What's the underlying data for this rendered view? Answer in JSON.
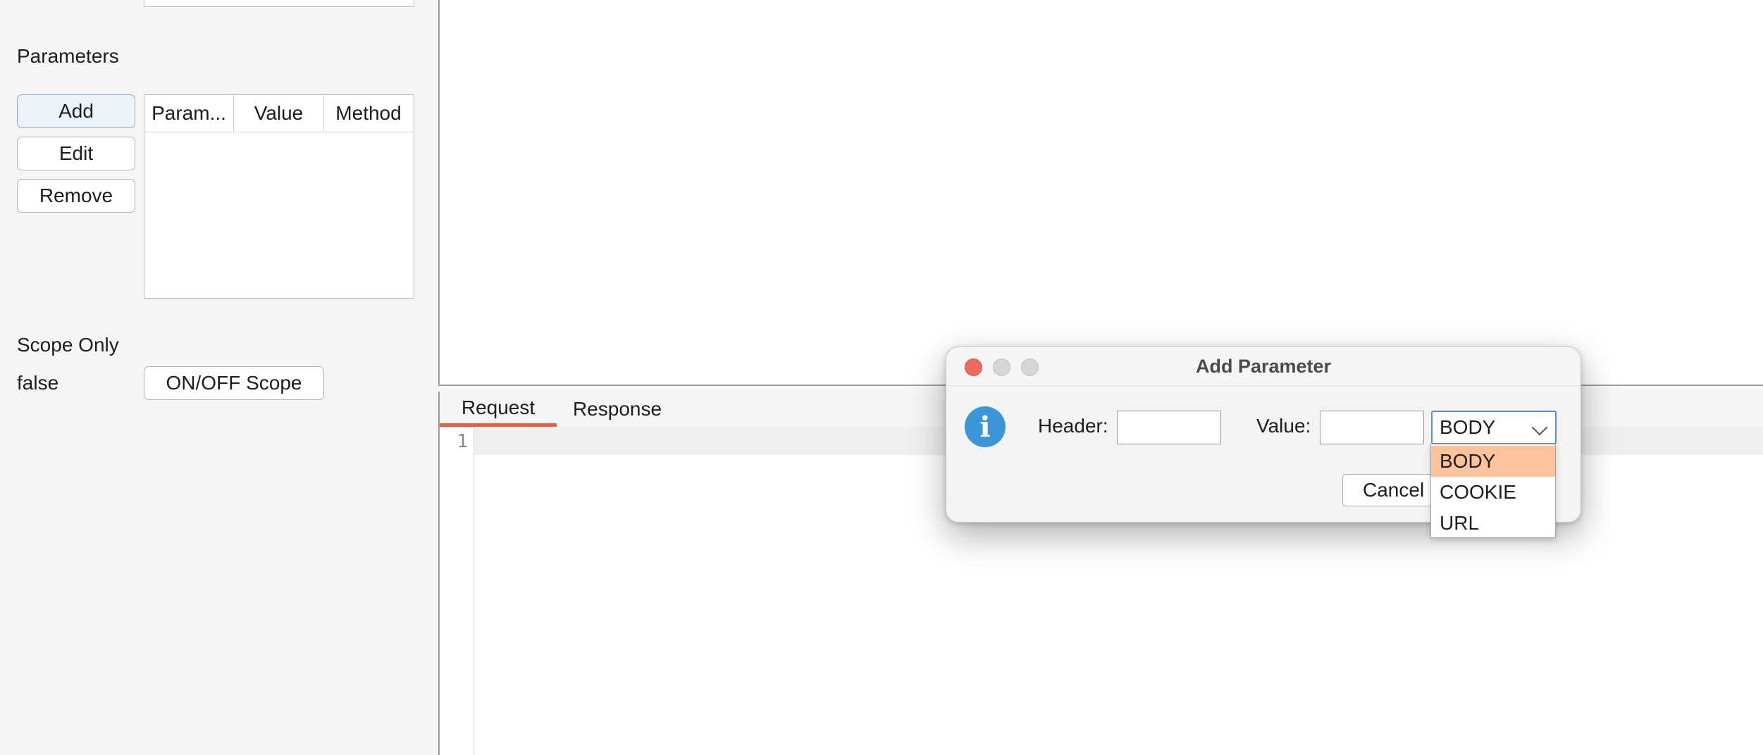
{
  "left_panel": {
    "parameters_heading": "Parameters",
    "buttons": {
      "add": "Add",
      "edit": "Edit",
      "remove": "Remove"
    },
    "table_columns": [
      "Param...",
      "Value",
      "Method"
    ],
    "scope_label": "Scope Only",
    "scope_value": "false",
    "scope_toggle": "ON/OFF Scope"
  },
  "tabs": {
    "request": "Request",
    "response": "Response",
    "active": "Request",
    "active_color": "#e65f3c"
  },
  "editor": {
    "line_numbers": [
      "1"
    ]
  },
  "dialog": {
    "title": "Add Parameter",
    "icon": "info-icon",
    "header_label": "Header:",
    "header_value": "",
    "value_label": "Value:",
    "value_value": "",
    "method_selected": "BODY",
    "cancel_label": "Cancel",
    "traffic_colors": {
      "close": "#ed6a5e",
      "minimize": "#d6d6d6",
      "zoom": "#d6d6d6"
    }
  },
  "dropdown": {
    "options": [
      "BODY",
      "COOKIE",
      "URL"
    ],
    "highlighted": "BODY",
    "highlight_color": "#fdc39c"
  }
}
